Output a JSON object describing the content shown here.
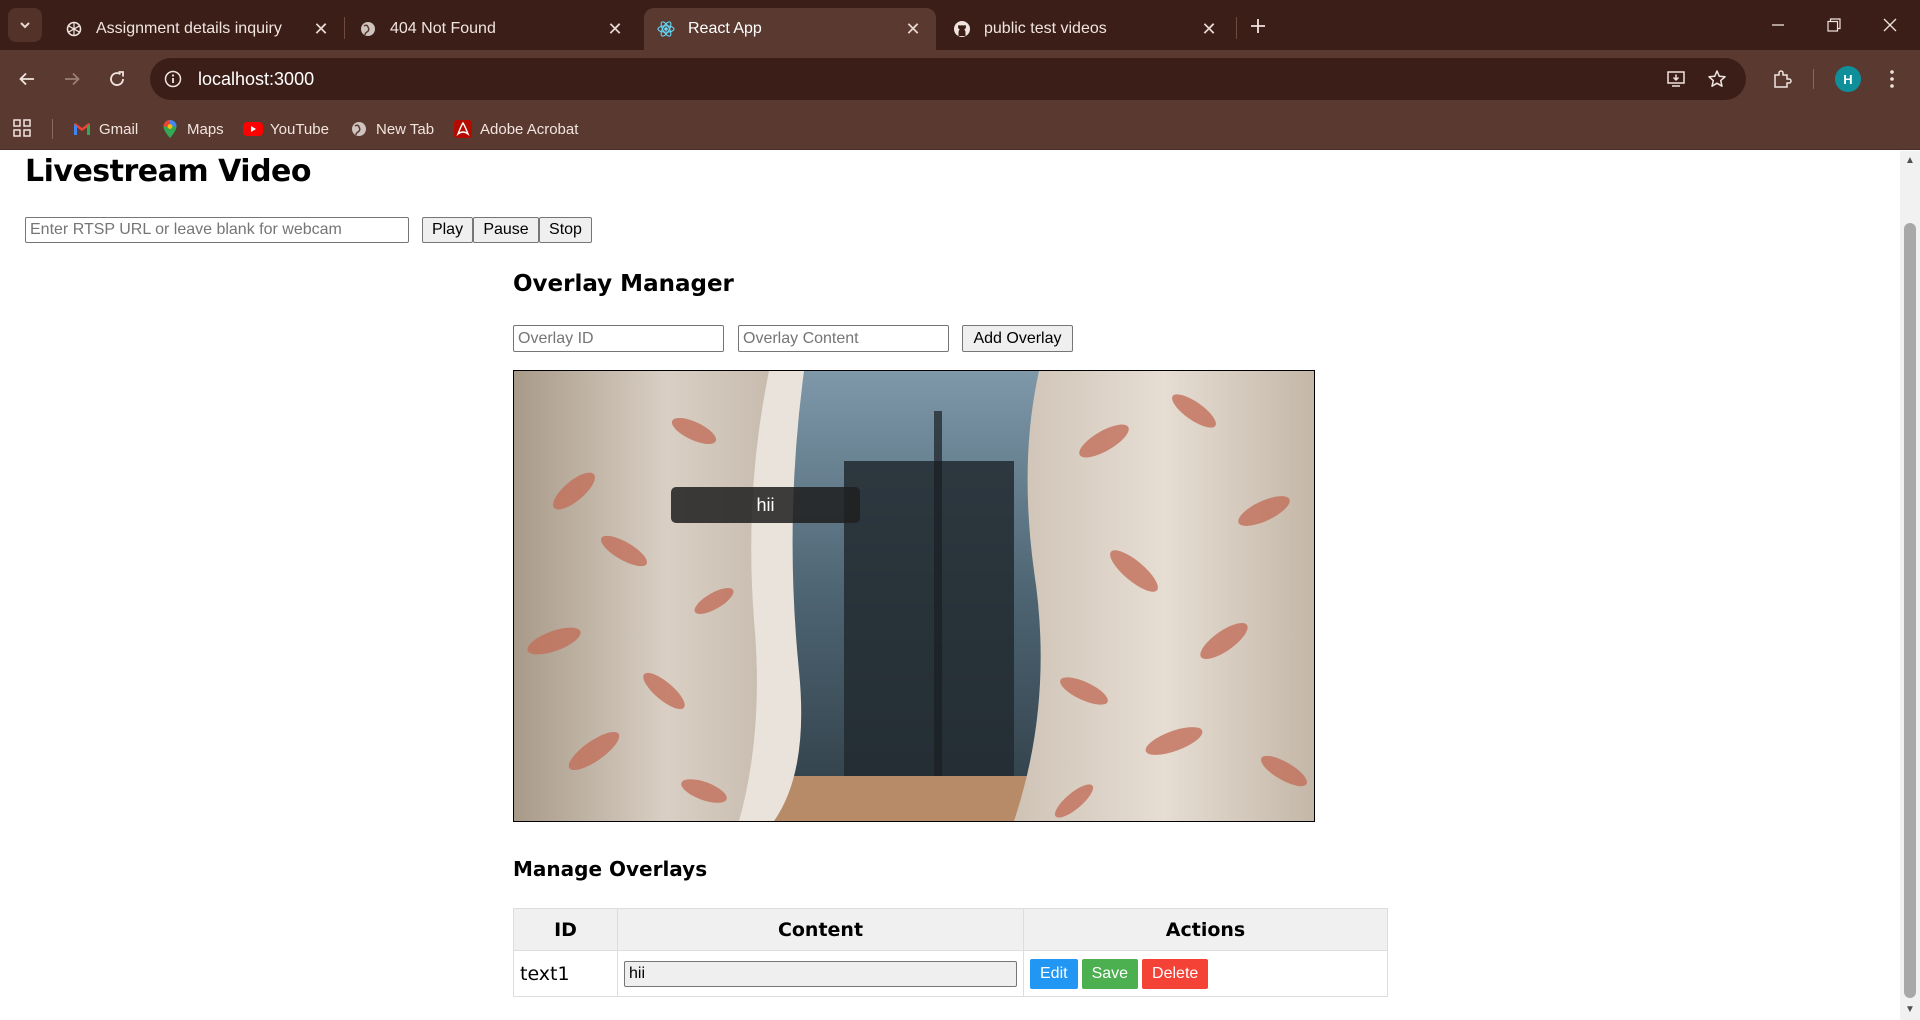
{
  "browser": {
    "tabs": [
      {
        "title": "Assignment details inquiry",
        "icon": "chatgpt-icon",
        "active": false
      },
      {
        "title": "404 Not Found",
        "icon": "globe-icon",
        "active": false
      },
      {
        "title": "React App",
        "icon": "react-icon",
        "active": true
      },
      {
        "title": "public test videos",
        "icon": "github-icon",
        "active": false
      }
    ],
    "url": "localhost:3000",
    "profile_initial": "H",
    "bookmarks": [
      {
        "label": "Gmail",
        "icon": "gmail-icon"
      },
      {
        "label": "Maps",
        "icon": "maps-icon"
      },
      {
        "label": "YouTube",
        "icon": "youtube-icon"
      },
      {
        "label": "New Tab",
        "icon": "globe-icon"
      },
      {
        "label": "Adobe Acrobat",
        "icon": "acrobat-icon"
      }
    ]
  },
  "page": {
    "title": "Livestream Video",
    "rtsp_placeholder": "Enter RTSP URL or leave blank for webcam",
    "controls": {
      "play": "Play",
      "pause": "Pause",
      "stop": "Stop"
    },
    "overlay_manager": {
      "title": "Overlay Manager",
      "id_placeholder": "Overlay ID",
      "content_placeholder": "Overlay Content",
      "add_label": "Add Overlay"
    },
    "video_overlay_text": "hii",
    "manage": {
      "title": "Manage Overlays",
      "columns": [
        "ID",
        "Content",
        "Actions"
      ],
      "rows": [
        {
          "id": "text1",
          "content": "hii"
        }
      ],
      "actions": {
        "edit": "Edit",
        "save": "Save",
        "delete": "Delete"
      }
    }
  },
  "colors": {
    "edit_button": "#2196f3",
    "save_button": "#4caf50",
    "delete_button": "#f44336",
    "chrome_dark": "#3b1e18",
    "chrome_toolbar": "#5a3a30"
  }
}
